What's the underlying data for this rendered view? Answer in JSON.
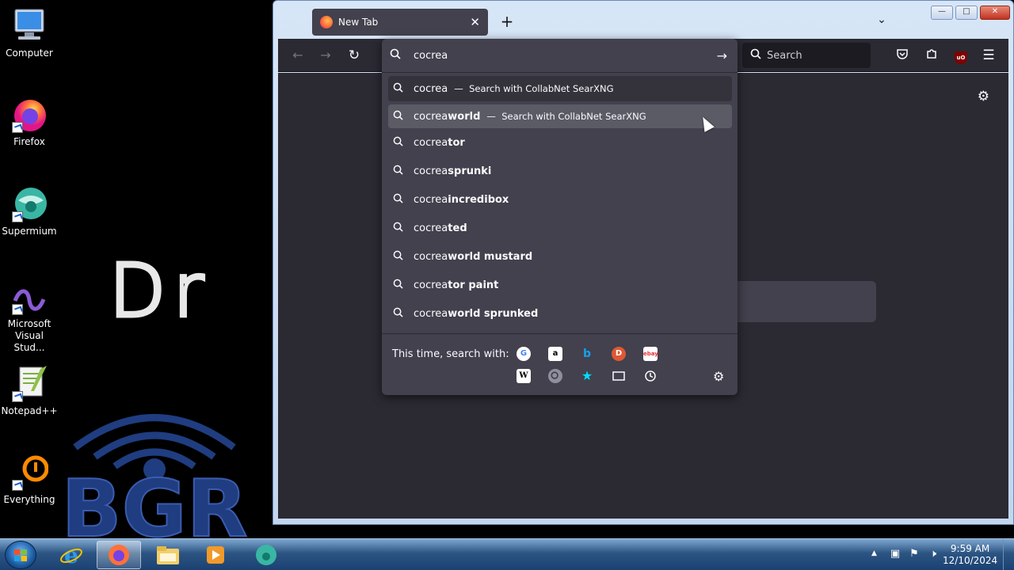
{
  "desktop": {
    "icons": [
      {
        "label": "Computer"
      },
      {
        "label": "Firefox"
      },
      {
        "label": "Supermium"
      },
      {
        "label": "Microsoft Visual Stud..."
      },
      {
        "label": "Notepad++"
      },
      {
        "label": "Everything"
      }
    ],
    "wallpaper_text": "Dr",
    "wallpaper_logo": "BGR"
  },
  "browser": {
    "tab_title": "New Tab",
    "search_placeholder": "Search",
    "urlbar_value": "cocrea",
    "accent": "#42414d"
  },
  "suggestions": [
    {
      "typed": "cocrea",
      "suggested": "",
      "action": "Search with CollabNet SearXNG"
    },
    {
      "typed": "cocrea",
      "suggested": " world",
      "action": "Search with CollabNet SearXNG"
    },
    {
      "typed": "cocrea",
      "suggested": "tor",
      "action": ""
    },
    {
      "typed": "cocrea",
      "suggested": " sprunki",
      "action": ""
    },
    {
      "typed": "cocrea",
      "suggested": " incredibox",
      "action": ""
    },
    {
      "typed": "cocrea",
      "suggested": "ted",
      "action": ""
    },
    {
      "typed": "cocrea",
      "suggested": " world mustard",
      "action": ""
    },
    {
      "typed": "cocrea",
      "suggested": "tor paint",
      "action": ""
    },
    {
      "typed": "cocrea",
      "suggested": " world sprunked",
      "action": ""
    }
  ],
  "one_off": {
    "label": "This time, search with:",
    "engines": [
      "google-icon",
      "amazon-icon",
      "bing-icon",
      "duckduckgo-icon",
      "ebay-icon",
      "wikipedia-icon",
      "searxng-icon",
      "bookmarks-icon",
      "tabs-icon",
      "history-icon"
    ]
  },
  "taskbar": {
    "time": "9:59 AM",
    "date": "12/10/2024"
  }
}
